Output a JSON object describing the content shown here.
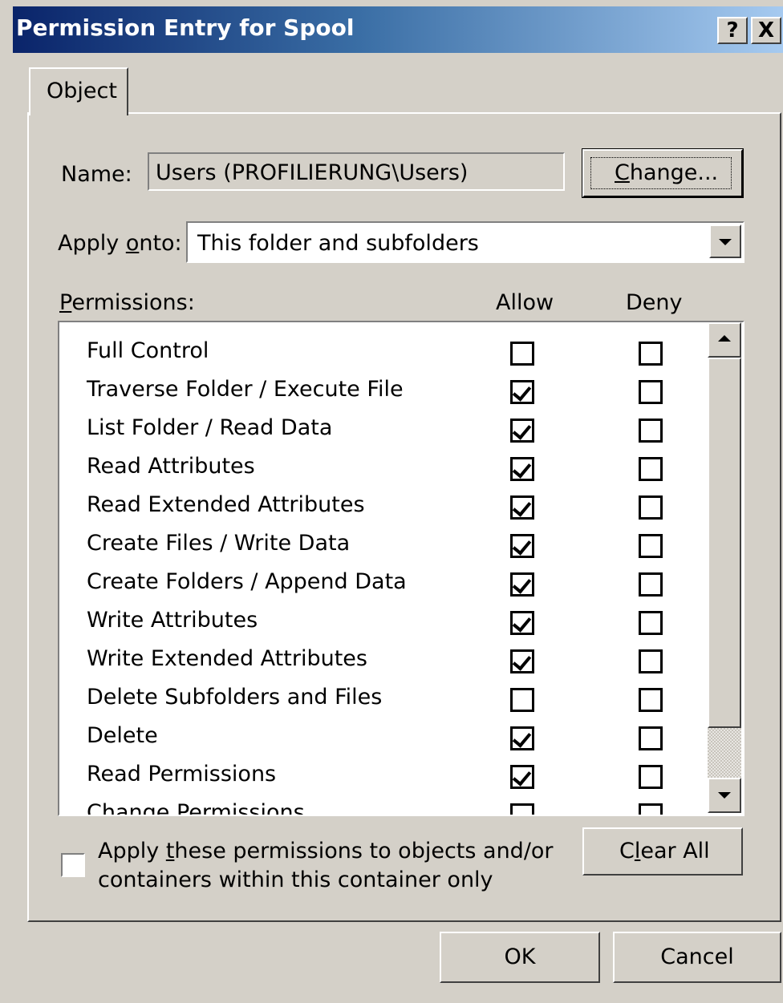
{
  "window": {
    "title": "Permission Entry for Spool",
    "help_label": "?",
    "close_label": "X"
  },
  "tabs": [
    {
      "label": "Object"
    }
  ],
  "name_field": {
    "label": "Name:",
    "value": "Users (PROFILIERUNG\\Users)"
  },
  "change_button": {
    "label_prefix": "",
    "label_underlined": "C",
    "label_rest": "hange..."
  },
  "apply_onto": {
    "label_prefix": "Apply ",
    "label_underlined": "o",
    "label_rest": "nto:",
    "selected": "This folder and subfolders"
  },
  "permissions": {
    "label_underlined": "P",
    "label_rest": "ermissions:",
    "allow_header": "Allow",
    "deny_header": "Deny",
    "rows": [
      {
        "name": "Full Control",
        "allow": false,
        "deny": false
      },
      {
        "name": "Traverse Folder / Execute File",
        "allow": true,
        "deny": false
      },
      {
        "name": "List Folder / Read Data",
        "allow": true,
        "deny": false
      },
      {
        "name": "Read Attributes",
        "allow": true,
        "deny": false
      },
      {
        "name": "Read Extended Attributes",
        "allow": true,
        "deny": false
      },
      {
        "name": "Create Files / Write Data",
        "allow": true,
        "deny": false
      },
      {
        "name": "Create Folders / Append Data",
        "allow": true,
        "deny": false
      },
      {
        "name": "Write Attributes",
        "allow": true,
        "deny": false
      },
      {
        "name": "Write Extended Attributes",
        "allow": true,
        "deny": false
      },
      {
        "name": "Delete Subfolders and Files",
        "allow": false,
        "deny": false
      },
      {
        "name": "Delete",
        "allow": true,
        "deny": false
      },
      {
        "name": "Read Permissions",
        "allow": true,
        "deny": false
      },
      {
        "name": "Change Permissions",
        "allow": false,
        "deny": false
      }
    ]
  },
  "apply_container_only": {
    "line1_prefix": "Apply ",
    "line1_underlined": "t",
    "line1_rest": "hese permissions to objects and/or",
    "line2": "containers within this container only",
    "checked": false
  },
  "clear_all_button": {
    "label_prefix": "C",
    "label_underlined": "l",
    "label_rest": "ear All"
  },
  "ok_button": {
    "label": "OK"
  },
  "cancel_button": {
    "label": "Cancel"
  }
}
